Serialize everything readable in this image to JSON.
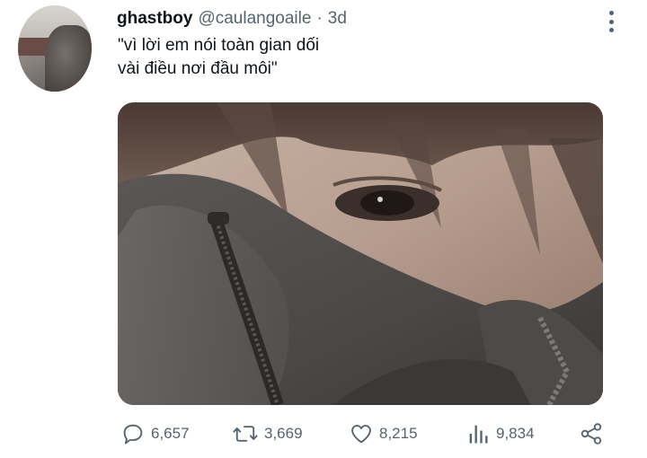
{
  "tweet": {
    "display_name": "ghastboy",
    "handle": "@caulangoaile",
    "separator": "·",
    "timestamp": "3d",
    "text_lines": [
      "\"vì lời em nói toàn gian dối",
      "vài điều nơi đầu môi\""
    ]
  },
  "actions": {
    "replies": "6,657",
    "retweets": "3,669",
    "likes": "8,215",
    "views": "9,834"
  },
  "icons": {
    "more": "more-vertical-icon",
    "reply": "reply-bubble-icon",
    "retweet": "retweet-icon",
    "like": "heart-icon",
    "views": "bar-chart-icon",
    "share": "share-icon"
  },
  "colors": {
    "text": "#0f1419",
    "secondary": "#536471"
  }
}
